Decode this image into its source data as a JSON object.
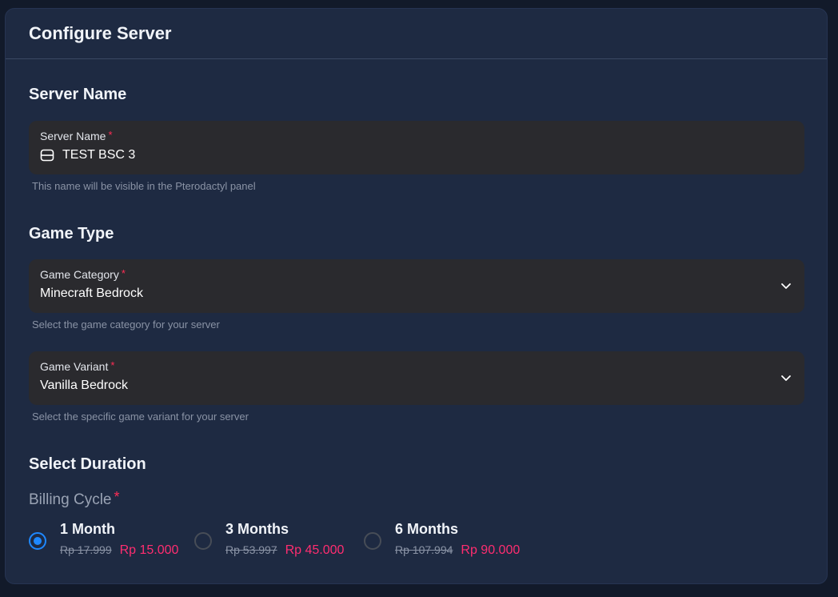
{
  "header": {
    "title": "Configure Server"
  },
  "server_name_section": {
    "title": "Server Name",
    "field_label": "Server Name",
    "required_mark": "*",
    "value": "TEST BSC 3",
    "helper": "This name will be visible in the Pterodactyl panel"
  },
  "game_type_section": {
    "title": "Game Type",
    "category": {
      "label": "Game Category",
      "required_mark": "*",
      "value": "Minecraft Bedrock",
      "helper": "Select the game category for your server"
    },
    "variant": {
      "label": "Game Variant",
      "required_mark": "*",
      "value": "Vanilla Bedrock",
      "helper": "Select the specific game variant for your server"
    }
  },
  "duration_section": {
    "title": "Select Duration",
    "billing_label": "Billing Cycle",
    "required_mark": "*",
    "options": [
      {
        "name": "1 Month",
        "old_price": "Rp 17.999",
        "price": "Rp 15.000",
        "selected": true
      },
      {
        "name": "3 Months",
        "old_price": "Rp 53.997",
        "price": "Rp 45.000",
        "selected": false
      },
      {
        "name": "6 Months",
        "old_price": "Rp 107.994",
        "price": "Rp 90.000",
        "selected": false
      }
    ]
  },
  "colors": {
    "accent": "#1e88ff",
    "required": "#ff2d55",
    "price": "#ff2d70",
    "card": "#1e2a42",
    "field": "#2a2a2e"
  },
  "icons": {
    "server_value": "server-icon",
    "dropdown": "chevron-down-icon"
  }
}
